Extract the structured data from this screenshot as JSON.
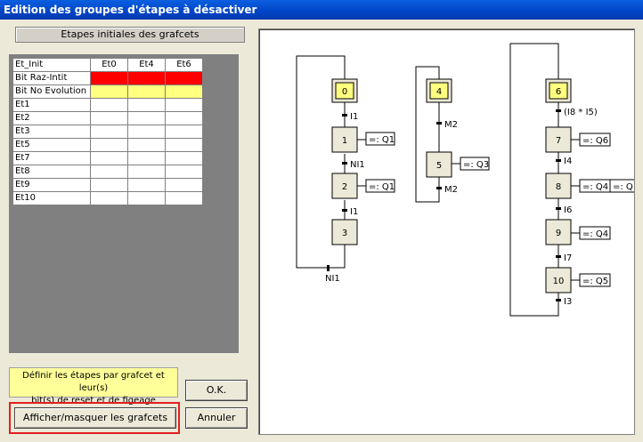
{
  "window": {
    "title": "Edition des groupes d'étapes à désactiver"
  },
  "panel": {
    "caption": "Etapes initiales des grafcets"
  },
  "grid": {
    "columns": [
      "Et_Init",
      "Et0",
      "Et4",
      "Et6"
    ],
    "rows": [
      "Bit Raz-Intit",
      "Bit No Evolution",
      "Et1",
      "Et2",
      "Et3",
      "Et5",
      "Et7",
      "Et8",
      "Et9",
      "Et10"
    ],
    "row_colors": {
      "Bit Raz-Intit": "#ff0000",
      "Bit No Evolution": "#ffff80"
    }
  },
  "note": {
    "line1": "Définir les étapes par grafcet et leur(s)",
    "line2": "bit(s) de reset et de figeage"
  },
  "buttons": {
    "ok": "O.K.",
    "cancel": "Annuler",
    "toggle": "Afficher/masquer les grafcets"
  },
  "grafcet": {
    "g0": {
      "initial": "0",
      "t_0_1": "I1",
      "step1": "1",
      "action1": "=: Q1",
      "t_1_2": "NI1",
      "step2": "2",
      "action2": "=: Q1",
      "t_2_3": "I1",
      "step3": "3",
      "t_3_0": "NI1"
    },
    "g4": {
      "initial": "4",
      "t_4_5": "M2",
      "step5": "5",
      "action5": "=: Q3",
      "t_5_4": "M2"
    },
    "g6": {
      "initial": "6",
      "t_6_7": "(I8 * I5)",
      "step7": "7",
      "action7": "=: Q6",
      "t_7_8": "I4",
      "step8": "8",
      "action8a": "=: Q4",
      "action8b": "=: Q",
      "t_8_9": "I6",
      "step9": "9",
      "action9": "=: Q4",
      "t_9_10": "I7",
      "step10": "10",
      "action10": "=: Q5",
      "t_10_6": "I3"
    }
  }
}
